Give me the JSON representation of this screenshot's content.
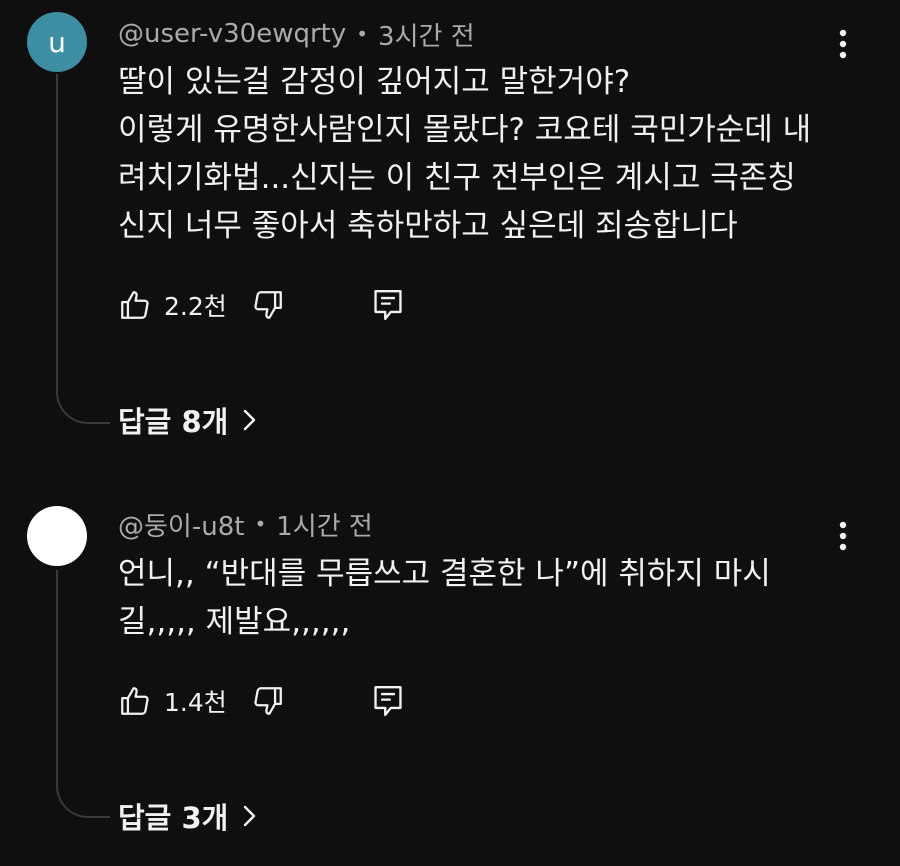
{
  "comments": [
    {
      "avatar_letter": "u",
      "avatar_color": "#3d8ea3",
      "username": "@user-v30ewqrty",
      "time": "3시간 전",
      "text_lines": [
        "딸이 있는걸 감정이 깊어지고 말한거야?",
        "이렇게 유명한사람인지 몰랐다? 코요테 국민가순데 내",
        "려치기화법...신지는 이 친구 전부인은 계시고 극존칭",
        "신지 너무 좋아서 축하만하고 싶은데 죄송합니다"
      ],
      "like_count": "2.2천",
      "replies_label": "답글 8개",
      "icons": {
        "like": "thumbs-up-icon",
        "dislike": "thumbs-down-icon",
        "reply": "comment-reply-icon",
        "more": "more-vert-icon",
        "chevron": "chevron-right-icon"
      }
    },
    {
      "avatar_letter": "",
      "avatar_color": "#ffffff",
      "username": "@둥이-u8t",
      "time": "1시간 전",
      "text_lines": [
        "언니,, “반대를 무릅쓰고 결혼한 나”에 취하지 마시",
        "길,,,,, 제발요,,,,,,"
      ],
      "like_count": "1.4천",
      "replies_label": "답글 3개",
      "icons": {
        "like": "thumbs-up-icon",
        "dislike": "thumbs-down-icon",
        "reply": "comment-reply-icon",
        "more": "more-vert-icon",
        "chevron": "chevron-right-icon"
      }
    }
  ]
}
